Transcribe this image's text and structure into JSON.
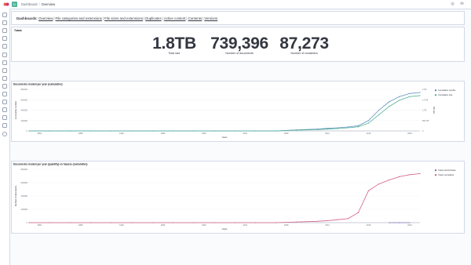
{
  "topbar": {
    "breadcrumb": [
      "Dashboard",
      "Overview"
    ],
    "space_initial": "D",
    "help_icon": "help-icon",
    "mail_icon": "newsfeed-icon"
  },
  "sidebar": {
    "icons": [
      "recent-icon",
      "discover-icon",
      "visualize-icon",
      "dashboard-icon",
      "canvas-icon",
      "maps-icon",
      "ml-icon",
      "infra-icon",
      "logs-icon",
      "apm-icon",
      "uptime-icon",
      "siem-icon",
      "devtools-icon",
      "monitoring-icon",
      "management-icon",
      "collapse-icon"
    ]
  },
  "nav_panel": {
    "label": "Dashboards:",
    "links": [
      "Overview",
      "File categories and extensions",
      "File sizes and extensions",
      "Duplicates",
      "Active content",
      "Contents",
      "Versions"
    ]
  },
  "totals": {
    "title": "Totals",
    "metrics": [
      {
        "value": "1.8TB",
        "label": "Total size"
      },
      {
        "value": "739,396",
        "label": "Number of documents"
      },
      {
        "value": "87,273",
        "label": "Number of containers"
      }
    ]
  },
  "colors": {
    "accent": "#54b399",
    "blue": "#6092c0",
    "pink": "#d36086",
    "purple": "#9170b8"
  },
  "chart_data": [
    {
      "type": "line",
      "title": "Documents created per year (cumulative)",
      "xlabel": "Years",
      "ylabel": "Cumulative number",
      "y2label": "File size",
      "x": [
        "1984",
        "1988",
        "1992",
        "1996",
        "2000",
        "2004",
        "2008",
        "2012",
        "2016",
        "2020"
      ],
      "x_values": [
        1983,
        1985,
        1987,
        1989,
        1991,
        1993,
        1995,
        1997,
        1999,
        2001,
        2003,
        2005,
        2007,
        2009,
        2011,
        2012,
        2013,
        2014,
        2015,
        2016,
        2017,
        2018,
        2019,
        2020,
        2021
      ],
      "yticks": [
        "0",
        "200000",
        "400000",
        "600000",
        "800000"
      ],
      "y2ticks": [
        "0",
        "500 TB",
        "1 TB",
        "1.5 TB",
        "2 TB"
      ],
      "ylim": [
        0,
        800000
      ],
      "series": [
        {
          "name": "Cumulative number",
          "color": "#6092c0",
          "values": [
            0,
            0,
            0,
            0,
            0,
            0,
            0,
            0,
            0,
            0,
            0,
            0,
            0,
            20000,
            35000,
            50000,
            60000,
            75000,
            100000,
            200000,
            400000,
            560000,
            660000,
            720000,
            740000
          ]
        },
        {
          "name": "Cumulative size",
          "color": "#54b399",
          "values": [
            0,
            0,
            0,
            0,
            0,
            0,
            0,
            0,
            0,
            0,
            0,
            0,
            0,
            15000,
            25000,
            35000,
            45000,
            60000,
            80000,
            150000,
            310000,
            470000,
            590000,
            660000,
            680000
          ]
        }
      ],
      "legend": "top-right"
    },
    {
      "type": "line",
      "title": "Documents created per year (quantity) en hausse (cumulative)",
      "xlabel": "Years",
      "ylabel": "Number of documents",
      "x": [
        "1984",
        "1988",
        "1992",
        "1996",
        "2000",
        "2004",
        "2008",
        "2012",
        "2016",
        "2020"
      ],
      "x_values": [
        1983,
        1985,
        1987,
        1989,
        1991,
        1993,
        1995,
        1997,
        1999,
        2001,
        2003,
        2005,
        2007,
        2009,
        2011,
        2012,
        2013,
        2014,
        2015,
        2016,
        2017,
        2018,
        2019,
        2020,
        2021
      ],
      "yticks": [
        "0",
        "200000",
        "400000",
        "600000",
        "800000"
      ],
      "ylim": [
        0,
        800000
      ],
      "series": [
        {
          "name": "Yearly doc/increase",
          "color": "#9170b8",
          "values": [
            null,
            null,
            null,
            null,
            null,
            null,
            null,
            null,
            null,
            null,
            null,
            null,
            null,
            null,
            null,
            null,
            null,
            null,
            null,
            null,
            null,
            0,
            0,
            0,
            null
          ]
        },
        {
          "name": "Yearly cumulative",
          "color": "#d36086",
          "values": [
            0,
            0,
            0,
            0,
            0,
            0,
            0,
            0,
            0,
            0,
            0,
            0,
            0,
            10000,
            20000,
            30000,
            45000,
            60000,
            150000,
            480000,
            580000,
            640000,
            690000,
            720000,
            735000
          ]
        }
      ],
      "legend": "top-right"
    }
  ]
}
